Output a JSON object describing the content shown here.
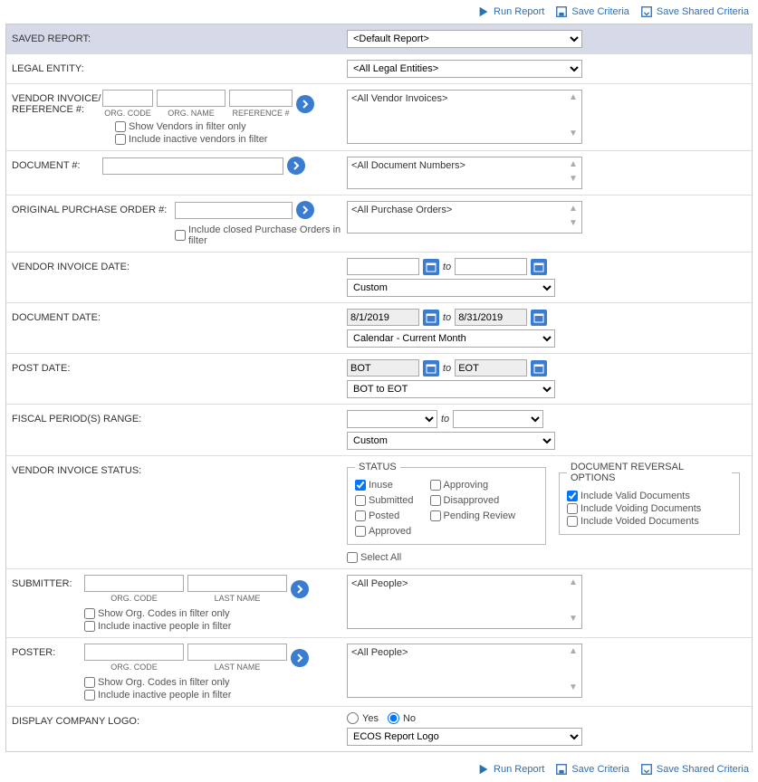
{
  "actions": {
    "run_report": "Run Report",
    "save_criteria": "Save Criteria",
    "save_shared_criteria": "Save Shared Criteria"
  },
  "labels": {
    "saved_report": "SAVED REPORT:",
    "legal_entity": "LEGAL ENTITY:",
    "vendor_invoice_ref": "VENDOR INVOICE/ REFERENCE #:",
    "org_code": "ORG. CODE",
    "org_name": "ORG. NAME",
    "reference_no": "REFERENCE #",
    "show_vendors_only": "Show Vendors in filter only",
    "include_inactive_vendors": "Include inactive vendors in filter",
    "document_no": "DOCUMENT #:",
    "original_po": "ORIGINAL PURCHASE ORDER #:",
    "include_closed_po": "Include closed Purchase Orders in filter",
    "vendor_invoice_date": "VENDOR INVOICE DATE:",
    "document_date": "DOCUMENT DATE:",
    "post_date": "POST DATE:",
    "fiscal_period_range": "FISCAL PERIOD(S) RANGE:",
    "vendor_invoice_status": "VENDOR INVOICE STATUS:",
    "status_legend": "STATUS",
    "doc_reversal_legend": "DOCUMENT REVERSAL OPTIONS",
    "select_all": "Select All",
    "submitter": "SUBMITTER:",
    "last_name": "LAST NAME",
    "show_org_codes_only": "Show Org. Codes in filter only",
    "include_inactive_people": "Include inactive people in filter",
    "poster": "POSTER:",
    "display_company_logo": "DISPLAY COMPANY LOGO:",
    "yes": "Yes",
    "no": "No",
    "to": "to"
  },
  "values": {
    "saved_report": "<Default Report>",
    "legal_entity": "<All Legal Entities>",
    "vendor_invoices_list": "<All Vendor Invoices>",
    "document_numbers_list": "<All Document Numbers>",
    "purchase_orders_list": "<All Purchase Orders>",
    "vendor_invoice_date_preset": "Custom",
    "doc_date_from": "8/1/2019",
    "doc_date_to": "8/31/2019",
    "doc_date_preset": "Calendar - Current Month",
    "post_date_from": "BOT",
    "post_date_to": "EOT",
    "post_date_preset": "BOT to EOT",
    "fiscal_preset": "Custom",
    "submitter_list": "<All People>",
    "poster_list": "<All People>",
    "logo_select": "ECOS Report Logo"
  },
  "status": {
    "inuse": "Inuse",
    "submitted": "Submitted",
    "posted": "Posted",
    "approved": "Approved",
    "approving": "Approving",
    "disapproved": "Disapproved",
    "pending_review": "Pending Review"
  },
  "reversal": {
    "valid": "Include Valid Documents",
    "voiding": "Include Voiding Documents",
    "voided": "Include Voided Documents"
  }
}
